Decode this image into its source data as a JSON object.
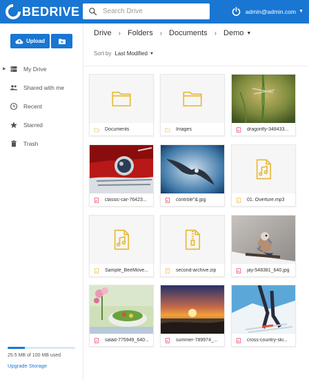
{
  "header": {
    "logo_text": "BEDRIVE",
    "search_placeholder": "Search Drive",
    "account_email": "admin@admin.com",
    "brand_color": "#1976d2"
  },
  "sidebar": {
    "upload_label": "Upload",
    "new_folder_icon": "folder-plus-icon",
    "items": [
      {
        "label": "My Drive",
        "icon": "drive-icon",
        "active": true
      },
      {
        "label": "Shared with me",
        "icon": "people-icon"
      },
      {
        "label": "Recent",
        "icon": "clock-icon"
      },
      {
        "label": "Starred",
        "icon": "star-icon"
      },
      {
        "label": "Trash",
        "icon": "trash-icon"
      }
    ],
    "storage_text": "25.5 MB of 100 MB used",
    "storage_fraction": 0.255,
    "upgrade_label": "Upgrade Storage"
  },
  "breadcrumb": {
    "items": [
      "Drive",
      "Folders",
      "Documents",
      "Demo"
    ]
  },
  "sort": {
    "label": "Sort by",
    "value": "Last Modified"
  },
  "files": [
    {
      "name": "Documents",
      "type": "folder"
    },
    {
      "name": "Images",
      "type": "folder"
    },
    {
      "name": "dragonfly-348433...",
      "type": "image",
      "thumb": "dragonfly"
    },
    {
      "name": "classic-car-76423...",
      "type": "image",
      "thumb": "car"
    },
    {
      "name": "contrôle\"&.jpg",
      "type": "image",
      "thumb": "bird"
    },
    {
      "name": "01. Overture.mp3",
      "type": "audio"
    },
    {
      "name": "Sample_BeeMove...",
      "type": "audio"
    },
    {
      "name": "second-archive.zip",
      "type": "archive"
    },
    {
      "name": "jay-548381_640.jpg",
      "type": "image",
      "thumb": "jay"
    },
    {
      "name": "salad-775949_640...",
      "type": "image",
      "thumb": "salad"
    },
    {
      "name": "summer-789974_...",
      "type": "image",
      "thumb": "sunset"
    },
    {
      "name": "cross-country-ski...",
      "type": "image",
      "thumb": "ski"
    }
  ]
}
